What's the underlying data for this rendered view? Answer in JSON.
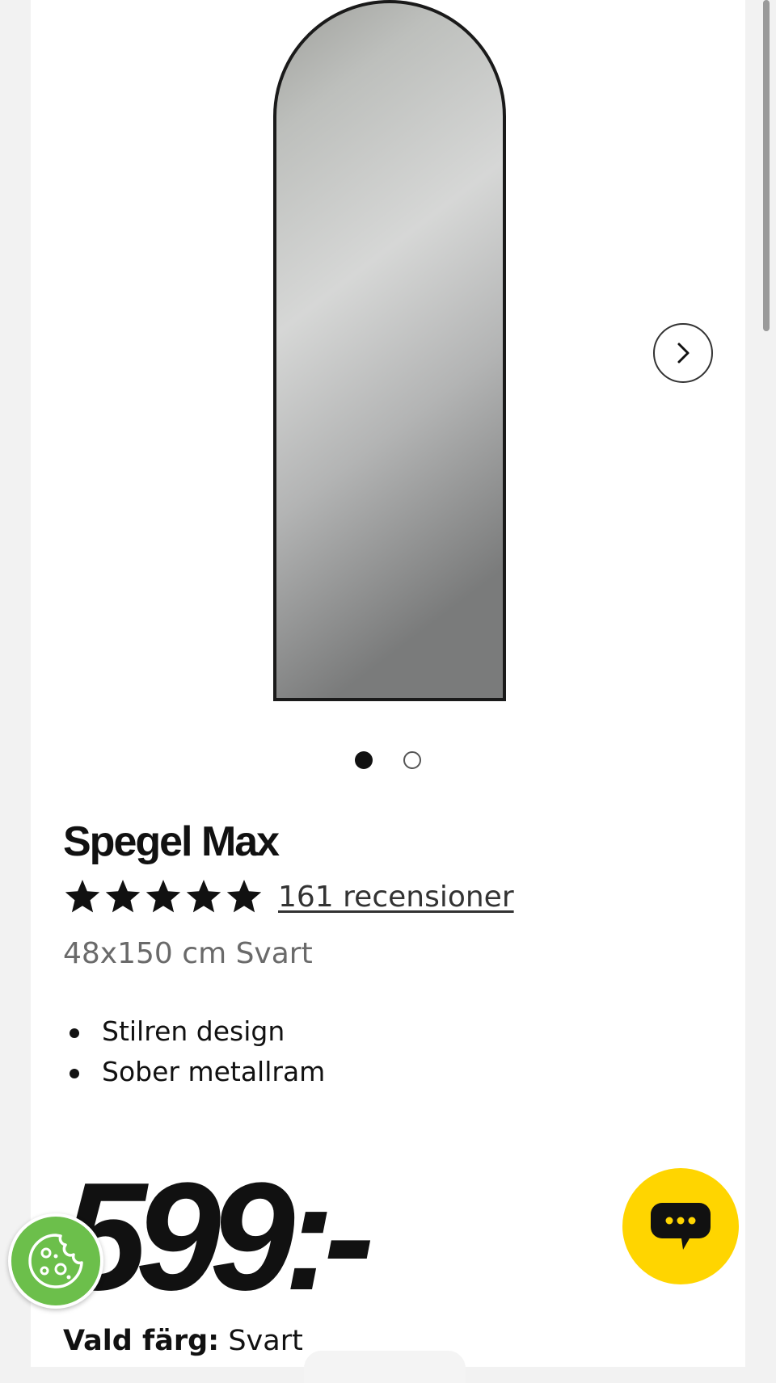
{
  "product": {
    "title": "Spegel Max",
    "rating_stars": 5,
    "reviews_text": "161 recensioner",
    "variant": "48x150 cm Svart",
    "features": [
      "Stilren design",
      "Sober metallram"
    ],
    "price": "599:-",
    "selected_color_label": "Vald färg:",
    "selected_color_value": "Svart"
  },
  "gallery": {
    "image_count": 2,
    "active_index": 0,
    "image_icon": "arched-mirror-image",
    "next_icon": "chevron-right-icon"
  },
  "chat": {
    "icon": "chat-bubble-icon",
    "color": "#ffd500"
  },
  "cookie": {
    "icon": "cookie-icon",
    "color": "#6cbf4b"
  }
}
